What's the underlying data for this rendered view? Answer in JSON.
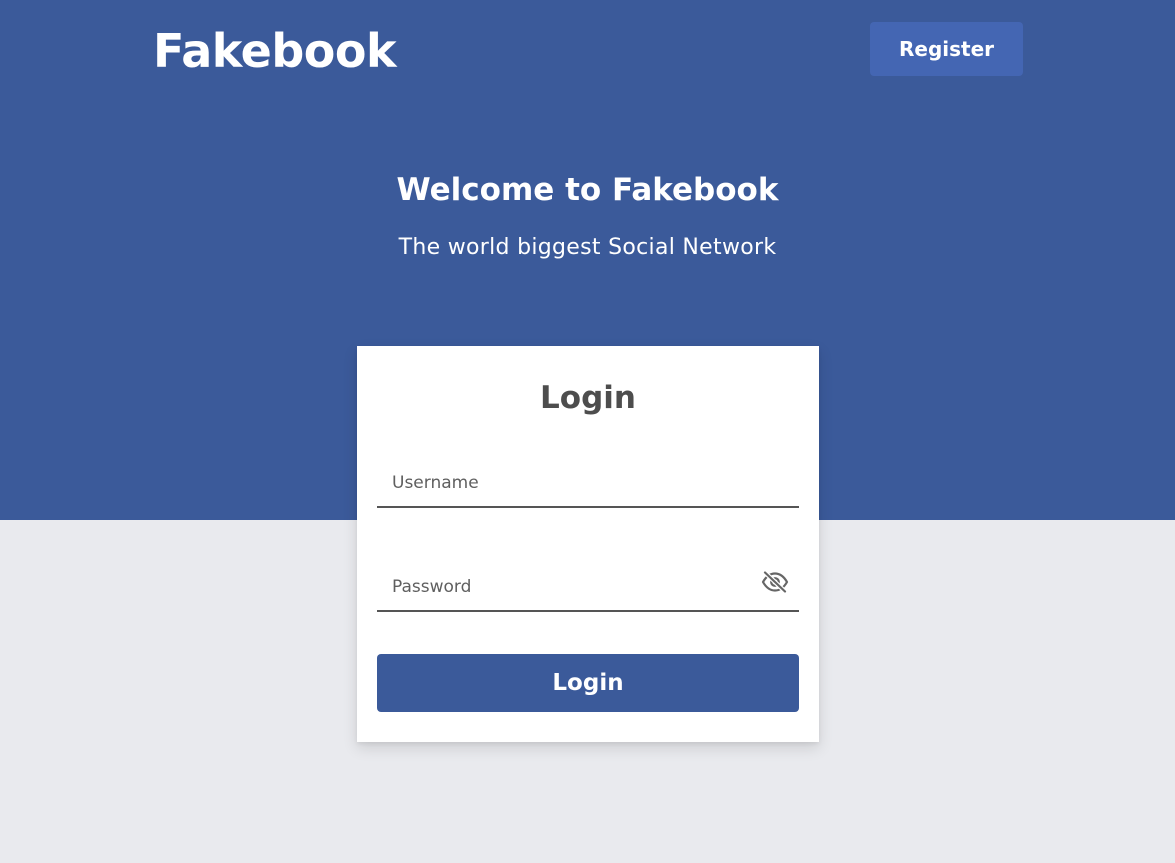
{
  "header": {
    "brand": "Fakebook",
    "register_label": "Register"
  },
  "hero": {
    "title": "Welcome to Fakebook",
    "subtitle": "The world biggest Social Network"
  },
  "login_card": {
    "title": "Login",
    "username": {
      "value": "",
      "placeholder": "Username"
    },
    "password": {
      "value": "",
      "placeholder": "Password",
      "toggle_icon": "eye-slash-icon"
    },
    "submit_label": "Login"
  },
  "colors": {
    "brand_blue": "#3b5a9a",
    "register_button": "#4466b3",
    "page_background": "#e9eaee",
    "card_background": "#ffffff",
    "title_gray": "#4d4d4d"
  }
}
